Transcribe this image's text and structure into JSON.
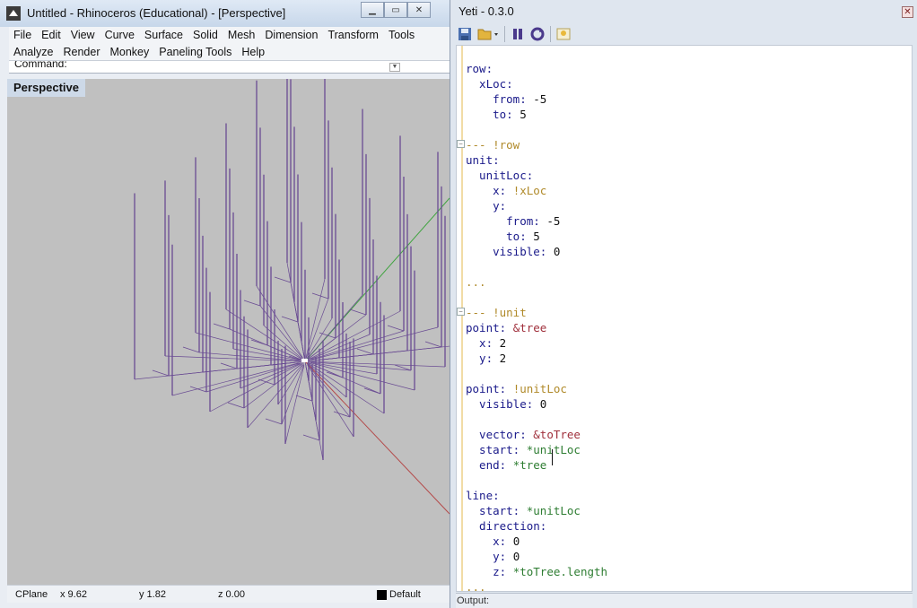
{
  "rhino": {
    "title": "Untitled - Rhinoceros (Educational) - [Perspective]",
    "menu_row1": [
      "File",
      "Edit",
      "View",
      "Curve",
      "Surface",
      "Solid",
      "Mesh",
      "Dimension",
      "Transform",
      "Tools"
    ],
    "menu_row2": [
      "Analyze",
      "Render",
      "Monkey",
      "Paneling Tools",
      "Help"
    ],
    "command_label": "Command:",
    "viewport_label": "Perspective",
    "status": {
      "cplane": "CPlane",
      "x": "x 9.62",
      "y": "y 1.82",
      "z": "z 0.00",
      "layer": "Default"
    },
    "colors": {
      "geometry": "#6a4c93",
      "viewport_bg": "#c0c0c0",
      "axis_x": "#b44a4a",
      "axis_y": "#3fa33f"
    }
  },
  "yeti": {
    "title": "Yeti - 0.3.0",
    "toolbar_icons": [
      "save-icon",
      "open-folder-icon",
      "pause-icon",
      "refresh-icon",
      "image-icon"
    ],
    "output_label": "Output:",
    "code_lines": [
      [
        [
          "k",
          "row:"
        ]
      ],
      [
        [
          "k",
          "  xLoc:"
        ]
      ],
      [
        [
          "k",
          "    from: "
        ],
        [
          "v",
          "-5"
        ]
      ],
      [
        [
          "k",
          "    to: "
        ],
        [
          "v",
          "5"
        ]
      ],
      [],
      [
        [
          "cmt",
          "--- !row"
        ]
      ],
      [
        [
          "k",
          "unit:"
        ]
      ],
      [
        [
          "k",
          "  unitLoc:"
        ]
      ],
      [
        [
          "k",
          "    x: "
        ],
        [
          "tag",
          "!xLoc"
        ]
      ],
      [
        [
          "k",
          "    y:"
        ]
      ],
      [
        [
          "k",
          "      from: "
        ],
        [
          "v",
          "-5"
        ]
      ],
      [
        [
          "k",
          "      to: "
        ],
        [
          "v",
          "5"
        ]
      ],
      [
        [
          "k",
          "    visible: "
        ],
        [
          "v",
          "0"
        ]
      ],
      [],
      [
        [
          "tag",
          "..."
        ]
      ],
      [],
      [
        [
          "cmt",
          "--- !unit"
        ]
      ],
      [
        [
          "k",
          "point: "
        ],
        [
          "anc",
          "&tree"
        ]
      ],
      [
        [
          "k",
          "  x: "
        ],
        [
          "v",
          "2"
        ]
      ],
      [
        [
          "k",
          "  y: "
        ],
        [
          "v",
          "2"
        ]
      ],
      [],
      [
        [
          "k",
          "point: "
        ],
        [
          "tag",
          "!unitLoc"
        ]
      ],
      [
        [
          "k",
          "  visible: "
        ],
        [
          "v",
          "0"
        ]
      ],
      [],
      [
        [
          "k",
          "  vector: "
        ],
        [
          "anc",
          "&toTree"
        ]
      ],
      [
        [
          "k",
          "  start: "
        ],
        [
          "al",
          "*unitLoc"
        ]
      ],
      [
        [
          "k",
          "  end: "
        ],
        [
          "al",
          "*tree"
        ]
      ],
      [],
      [
        [
          "k",
          "line:"
        ]
      ],
      [
        [
          "k",
          "  start: "
        ],
        [
          "al",
          "*unitLoc"
        ]
      ],
      [
        [
          "k",
          "  direction:"
        ]
      ],
      [
        [
          "k",
          "    x: "
        ],
        [
          "v",
          "0"
        ]
      ],
      [
        [
          "k",
          "    y: "
        ],
        [
          "v",
          "0"
        ]
      ],
      [
        [
          "k",
          "    z: "
        ],
        [
          "al",
          "*toTree.length"
        ]
      ],
      [
        [
          "tag",
          "..."
        ]
      ]
    ]
  }
}
